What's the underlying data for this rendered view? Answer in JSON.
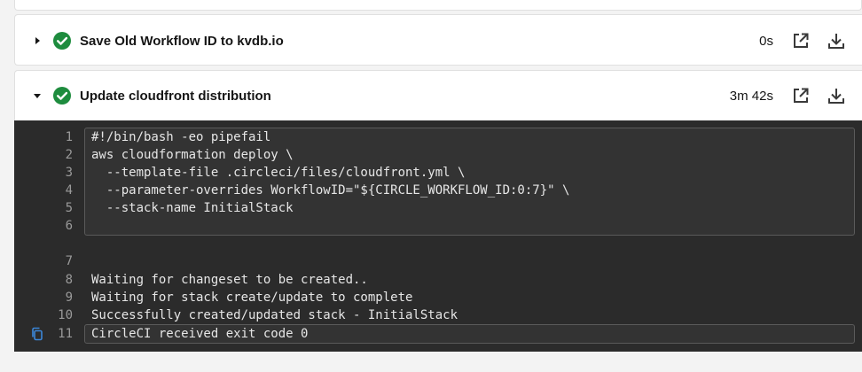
{
  "steps": [
    {
      "title": "Save Old Workflow ID to kvdb.io",
      "duration": "0s",
      "expanded": false,
      "status": "success"
    },
    {
      "title": "Update cloudfront distribution",
      "duration": "3m 42s",
      "expanded": true,
      "status": "success"
    }
  ],
  "terminal": {
    "lines": [
      {
        "num": "1",
        "text": "#!/bin/bash -eo pipefail"
      },
      {
        "num": "2",
        "text": "aws cloudformation deploy \\"
      },
      {
        "num": "3",
        "text": "  --template-file .circleci/files/cloudfront.yml \\"
      },
      {
        "num": "4",
        "text": "  --parameter-overrides WorkflowID=\"${CIRCLE_WORKFLOW_ID:0:7}\" \\"
      },
      {
        "num": "5",
        "text": "  --stack-name InitialStack"
      },
      {
        "num": "6",
        "text": ""
      },
      {
        "num": "7",
        "text": ""
      },
      {
        "num": "8",
        "text": "Waiting for changeset to be created.."
      },
      {
        "num": "9",
        "text": "Waiting for stack create/update to complete"
      },
      {
        "num": "10",
        "text": "Successfully created/updated stack - InitialStack"
      },
      {
        "num": "11",
        "text": "CircleCI received exit code 0"
      }
    ]
  },
  "colors": {
    "success": "#1e8c3e",
    "terminal_bg": "#2b2b2b",
    "icon": "#3a3a3a",
    "copy_icon": "#3b86d8"
  },
  "icons": {
    "collapsed": "chevron-right-icon",
    "expanded": "chevron-down-icon",
    "status": "check-circle-icon",
    "open": "open-external-icon",
    "download": "download-icon",
    "copy": "copy-icon"
  }
}
